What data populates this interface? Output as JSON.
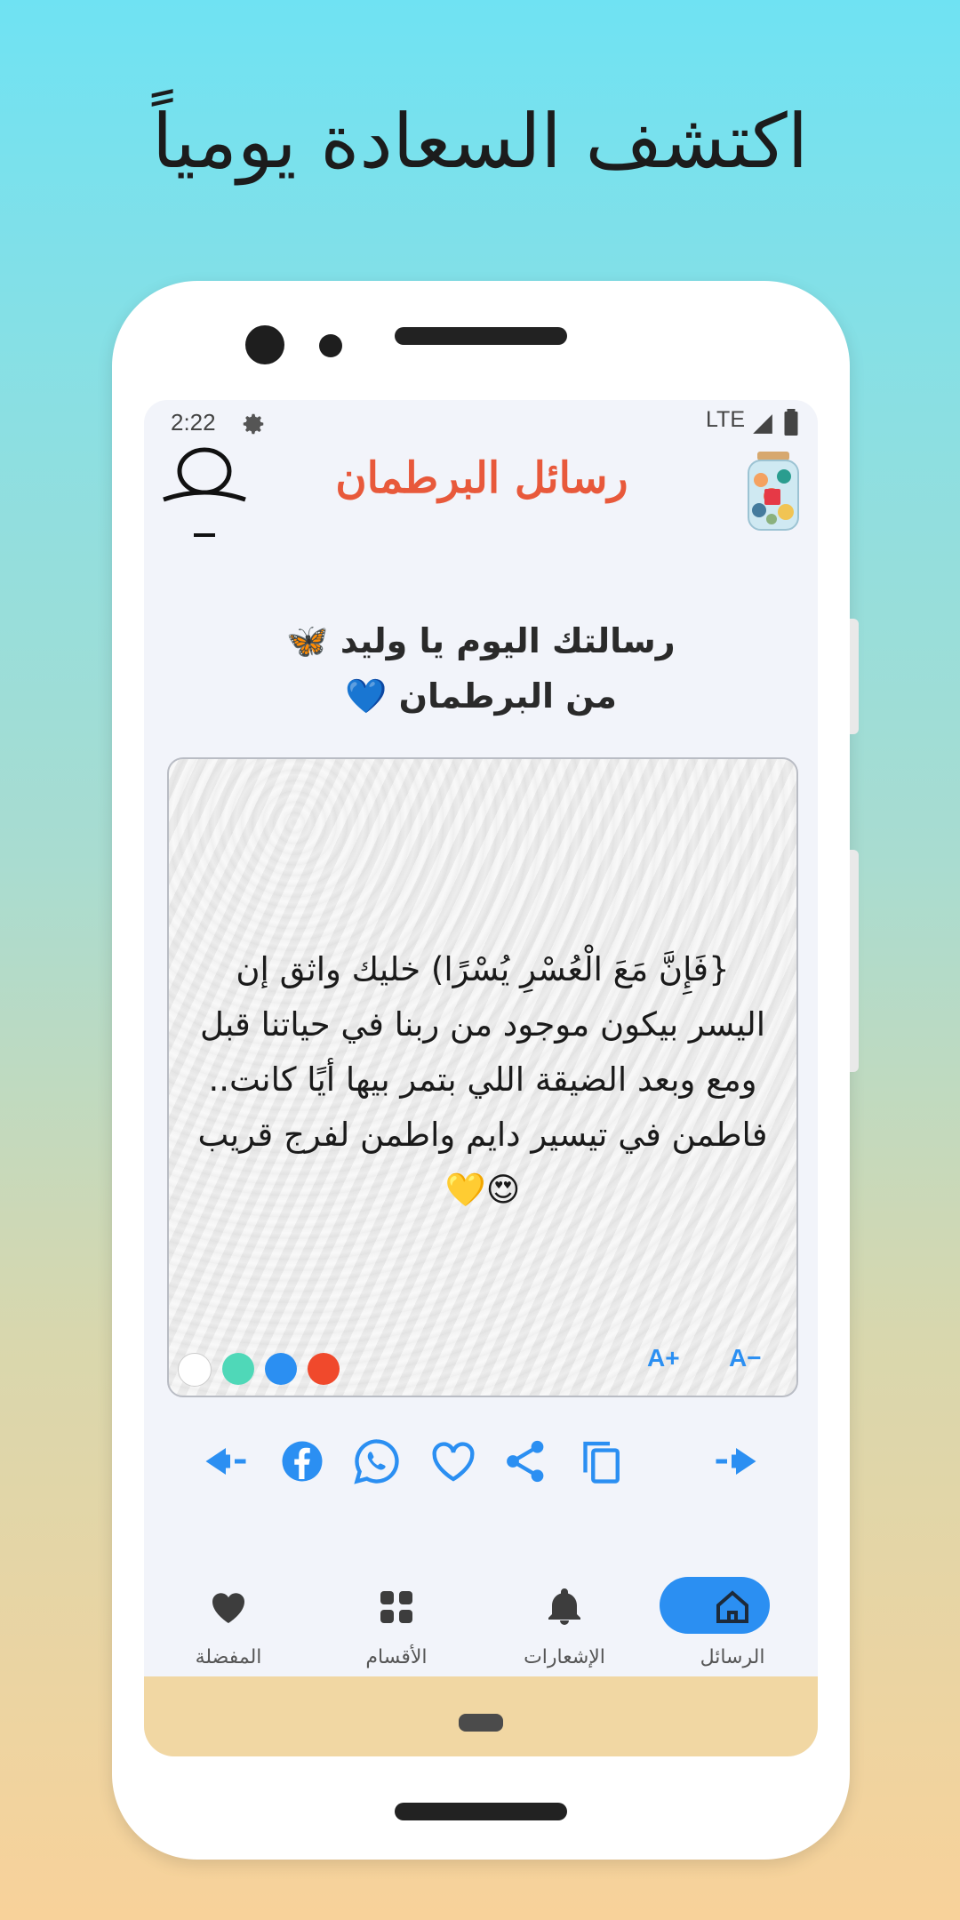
{
  "promo": {
    "headline": "اكتشف السعادة يومياً"
  },
  "status": {
    "time": "2:22",
    "network": "LTE"
  },
  "header": {
    "app_title": "رسائل البرطمان",
    "avatar_icon": "user-avatar-icon",
    "logo_icon": "jar-logo-icon"
  },
  "greeting": {
    "line1": "رسالتك اليوم يا وليد 🦋",
    "line2": "من البرطمان 💙"
  },
  "card": {
    "message": "{فَإِنَّ مَعَ الْعُسْرِ يُسْرًا) خليك واثق إن اليسر بيكون موجود من ربنا في حياتنا قبل ومع وبعد الضيقة اللي بتمر بيها أيًا كانت.. فاطمن في تيسير دايم واطمن لفرج قريب 😍💛",
    "font_increase": "A+",
    "font_decrease": "A−",
    "color_options": [
      "#ffffff",
      "#4fd8b8",
      "#2b8ff2",
      "#f0492c"
    ]
  },
  "actions": [
    "previous-icon",
    "facebook-icon",
    "whatsapp-icon",
    "heart-icon",
    "share-icon",
    "copy-icon",
    "next-icon"
  ],
  "nav": {
    "favorites": "المفضلة",
    "sections": "الأقسام",
    "notifications": "الإشعارات",
    "messages": "الرسائل"
  },
  "colors": {
    "accent": "#2b8ff2",
    "title": "#e8593b"
  }
}
